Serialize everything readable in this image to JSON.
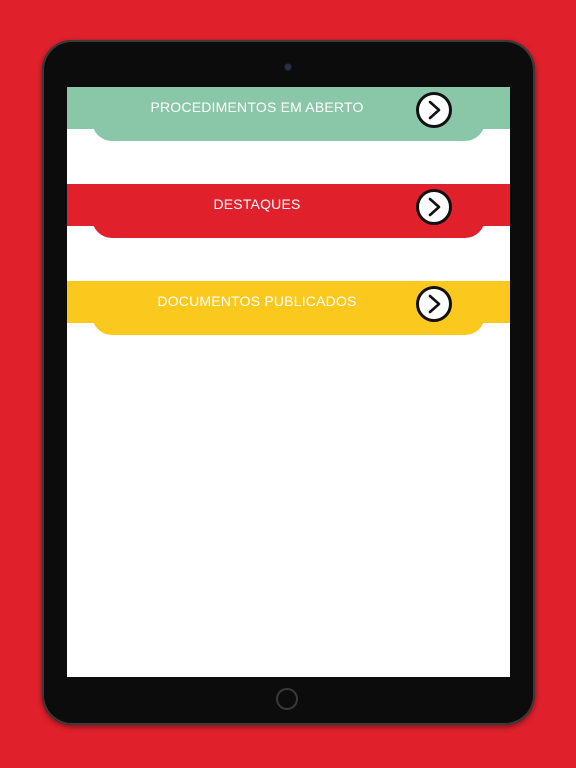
{
  "menu": {
    "items": [
      {
        "label": "PROCEDIMENTOS EM ABERTO",
        "color": "#8ac6a8"
      },
      {
        "label": "DESTAQUES",
        "color": "#e0212c"
      },
      {
        "label": "DOCUMENTOS PUBLICADOS",
        "color": "#fbc81e"
      }
    ],
    "arrow_icon": "chevron-right-circle-icon"
  },
  "background_color": "#e0212c"
}
